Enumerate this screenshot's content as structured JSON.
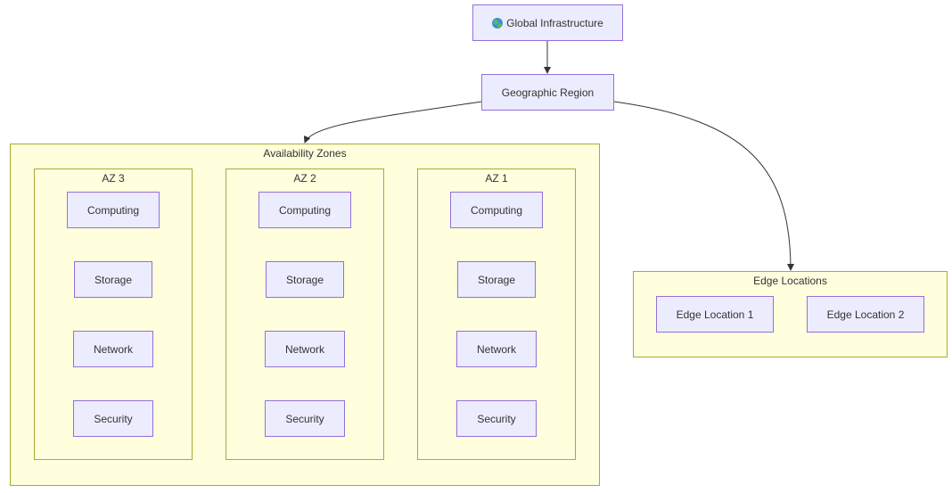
{
  "colors": {
    "node_fill": "#ECECFF",
    "node_stroke": "#9370DB",
    "cluster_fill": "#ffffde",
    "cluster_stroke": "#aaaa33",
    "edge": "#333333"
  },
  "nodes": {
    "global": {
      "label": "Global Infrastructure",
      "icon": "globe-icon"
    },
    "region": {
      "label": "Geographic Region"
    }
  },
  "availability_zones": {
    "title": "Availability Zones",
    "zones": [
      {
        "title": "AZ 3",
        "items": [
          "Computing",
          "Storage",
          "Network",
          "Security"
        ]
      },
      {
        "title": "AZ 2",
        "items": [
          "Computing",
          "Storage",
          "Network",
          "Security"
        ]
      },
      {
        "title": "AZ 1",
        "items": [
          "Computing",
          "Storage",
          "Network",
          "Security"
        ]
      }
    ]
  },
  "edge_locations": {
    "title": "Edge Locations",
    "items": [
      "Edge Location 1",
      "Edge Location 2"
    ]
  },
  "edges": [
    {
      "from": "Global Infrastructure",
      "to": "Geographic Region"
    },
    {
      "from": "Geographic Region",
      "to": "Availability Zones"
    },
    {
      "from": "Geographic Region",
      "to": "Edge Locations"
    }
  ]
}
